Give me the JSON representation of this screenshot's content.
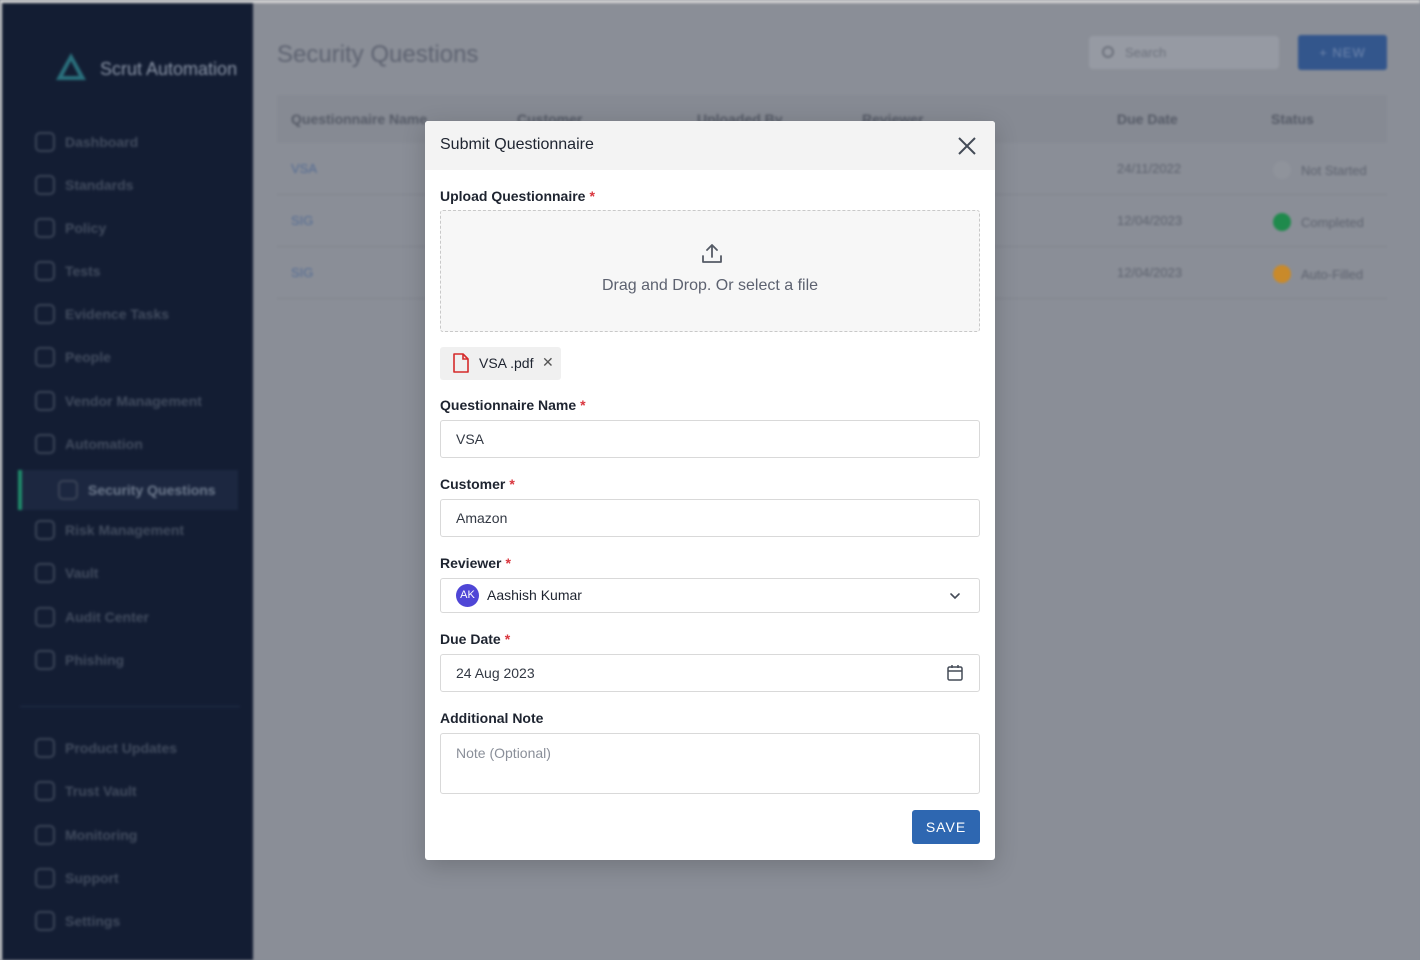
{
  "background": {
    "app_name": "Scrut Automation",
    "page_title": "Security Questions",
    "search_placeholder": "Search",
    "new_button": "+ NEW",
    "sidebar": {
      "items": [
        {
          "label": "Dashboard",
          "icon": "dashboard-icon"
        },
        {
          "label": "Standards",
          "icon": "standards-icon"
        },
        {
          "label": "Policy",
          "icon": "policy-icon"
        },
        {
          "label": "Tests",
          "icon": "tests-icon"
        },
        {
          "label": "Evidence Tasks",
          "icon": "evidence-icon"
        },
        {
          "label": "People",
          "icon": "people-icon"
        },
        {
          "label": "Vendor Management",
          "icon": "vendor-icon"
        },
        {
          "label": "Automation",
          "icon": "automation-icon"
        },
        {
          "label": "Security Questions",
          "icon": "security-questions-icon"
        },
        {
          "label": "Risk Management",
          "icon": "risk-icon"
        },
        {
          "label": "Vault",
          "icon": "vault-icon"
        },
        {
          "label": "Audit Center",
          "icon": "audit-icon"
        },
        {
          "label": "Phishing",
          "icon": "phishing-icon"
        }
      ],
      "bottom_items": [
        {
          "label": "Product Updates",
          "icon": "megaphone-icon"
        },
        {
          "label": "Trust Vault",
          "icon": "flag-icon"
        },
        {
          "label": "Monitoring",
          "icon": "chart-icon"
        },
        {
          "label": "Support",
          "icon": "support-icon"
        },
        {
          "label": "Settings",
          "icon": "gear-icon"
        }
      ],
      "active": "Security Questions"
    },
    "table": {
      "columns": [
        "Questionnaire Name",
        "Customer",
        "Uploaded By",
        "Reviewer",
        "Due Date",
        "Status"
      ],
      "rows": [
        {
          "name": "VSA",
          "due_date": "24/11/2022",
          "status": "Not Started",
          "status_color": "#8f939b"
        },
        {
          "name": "SIG",
          "due_date": "12/04/2023",
          "status": "Completed",
          "status_color": "#1f8a4c"
        },
        {
          "name": "SIG",
          "due_date": "12/04/2023",
          "status": "Auto-Filled",
          "status_color": "#c98a2a"
        }
      ]
    }
  },
  "modal": {
    "title": "Submit Questionnaire",
    "upload_label": "Upload Questionnaire",
    "dropzone_text": "Drag and Drop. Or select a file",
    "attached_file": "VSA .pdf",
    "fields": {
      "name_label": "Questionnaire Name",
      "name_value": "VSA",
      "customer_label": "Customer",
      "customer_value": "Amazon",
      "reviewer_label": "Reviewer",
      "reviewer_initials": "AK",
      "reviewer_value": "Aashish Kumar",
      "due_date_label": "Due Date",
      "due_date_value": "24 Aug 2023",
      "note_label": "Additional Note",
      "note_placeholder": "Note (Optional)"
    },
    "required_mark": "*",
    "save_label": "SAVE"
  },
  "colors": {
    "primary": "#2e67b1",
    "required": "#d9363e",
    "avatar": "#4f46d6",
    "sidebar": "#131d33"
  }
}
